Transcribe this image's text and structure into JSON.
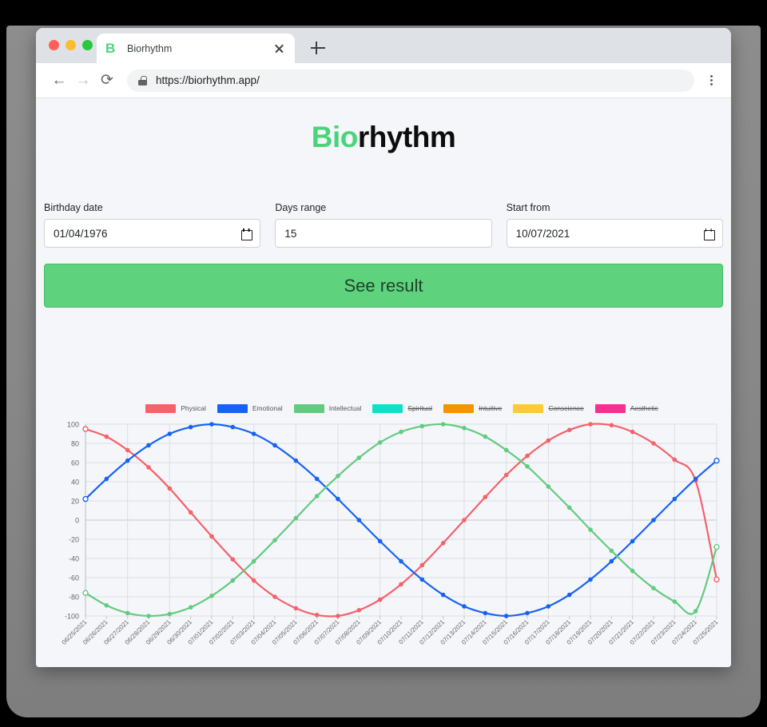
{
  "browser": {
    "tab_title": "Biorhythm",
    "favicon_letter": "B",
    "favicon_color": "#4ad47a",
    "url": "https://biorhythm.app/",
    "back_icon": "←",
    "forward_icon": "→",
    "reload_icon": "⟳",
    "new_tab_icon": "plus-icon",
    "close_tab_icon": "close-icon",
    "menu_icon": "kebab-menu-icon",
    "lock_icon": "lock-icon"
  },
  "app": {
    "title_prefix": "Bio",
    "title_suffix": "rhythm",
    "brand_color": "#4ad47a"
  },
  "form": {
    "fields": [
      {
        "label": "Birthday date",
        "value": "01/04/1976",
        "icon": "calendar-icon"
      },
      {
        "label": "Days range",
        "value": "15",
        "icon": ""
      },
      {
        "label": "Start from",
        "value": "10/07/2021",
        "icon": "calendar-icon"
      }
    ],
    "submit_label": "See result",
    "submit_color": "#5fd27e"
  },
  "chart_data": {
    "type": "line",
    "title": "",
    "xlabel": "",
    "ylabel": "",
    "ylim": [
      -100,
      100
    ],
    "yticks": [
      100,
      80,
      60,
      40,
      20,
      0,
      -20,
      -40,
      -60,
      -80,
      -100
    ],
    "grid": true,
    "legend_position": "top",
    "x": [
      "06/25/2021",
      "06/26/2021",
      "06/27/2021",
      "06/28/2021",
      "06/29/2021",
      "06/30/2021",
      "07/01/2021",
      "07/02/2021",
      "07/03/2021",
      "07/04/2021",
      "07/05/2021",
      "07/06/2021",
      "07/07/2021",
      "07/08/2021",
      "07/09/2021",
      "07/10/2021",
      "07/11/2021",
      "07/12/2021",
      "07/13/2021",
      "07/14/2021",
      "07/15/2021",
      "07/16/2021",
      "07/17/2021",
      "07/18/2021",
      "07/19/2021",
      "07/20/2021",
      "07/21/2021",
      "07/22/2021",
      "07/23/2021",
      "07/24/2021",
      "07/25/2021"
    ],
    "series": [
      {
        "name": "Physical",
        "color": "#f4626a",
        "visible": true,
        "values": [
          95,
          87,
          73,
          55,
          33,
          8,
          -17,
          -41,
          -63,
          -80,
          -92,
          -99,
          -100,
          -94,
          -83,
          -67,
          -47,
          -24,
          0,
          24,
          47,
          67,
          83,
          94,
          100,
          99,
          92,
          80,
          63,
          41,
          -62
        ]
      },
      {
        "name": "Emotional",
        "color": "#1763f5",
        "visible": true,
        "values": [
          22,
          43,
          62,
          78,
          90,
          97,
          100,
          97,
          90,
          78,
          62,
          43,
          22,
          0,
          -22,
          -43,
          -62,
          -78,
          -90,
          -97,
          -100,
          -97,
          -90,
          -78,
          -62,
          -43,
          -22,
          0,
          22,
          43,
          62
        ]
      },
      {
        "name": "Intellectual",
        "color": "#63cb80",
        "visible": true,
        "values": [
          -76,
          -89,
          -97,
          -100,
          -98,
          -91,
          -79,
          -63,
          -43,
          -21,
          2,
          25,
          46,
          65,
          81,
          92,
          98,
          100,
          96,
          87,
          73,
          56,
          35,
          13,
          -10,
          -32,
          -53,
          -71,
          -85,
          -95,
          -28
        ]
      },
      {
        "name": "Spiritual",
        "color": "#0fe0c6",
        "visible": false,
        "values": []
      },
      {
        "name": "Intuitive",
        "color": "#f59300",
        "visible": false,
        "values": []
      },
      {
        "name": "Conscience",
        "color": "#ffc93c",
        "visible": false,
        "values": []
      },
      {
        "name": "Aesthetic",
        "color": "#f5308f",
        "visible": false,
        "values": []
      }
    ]
  }
}
